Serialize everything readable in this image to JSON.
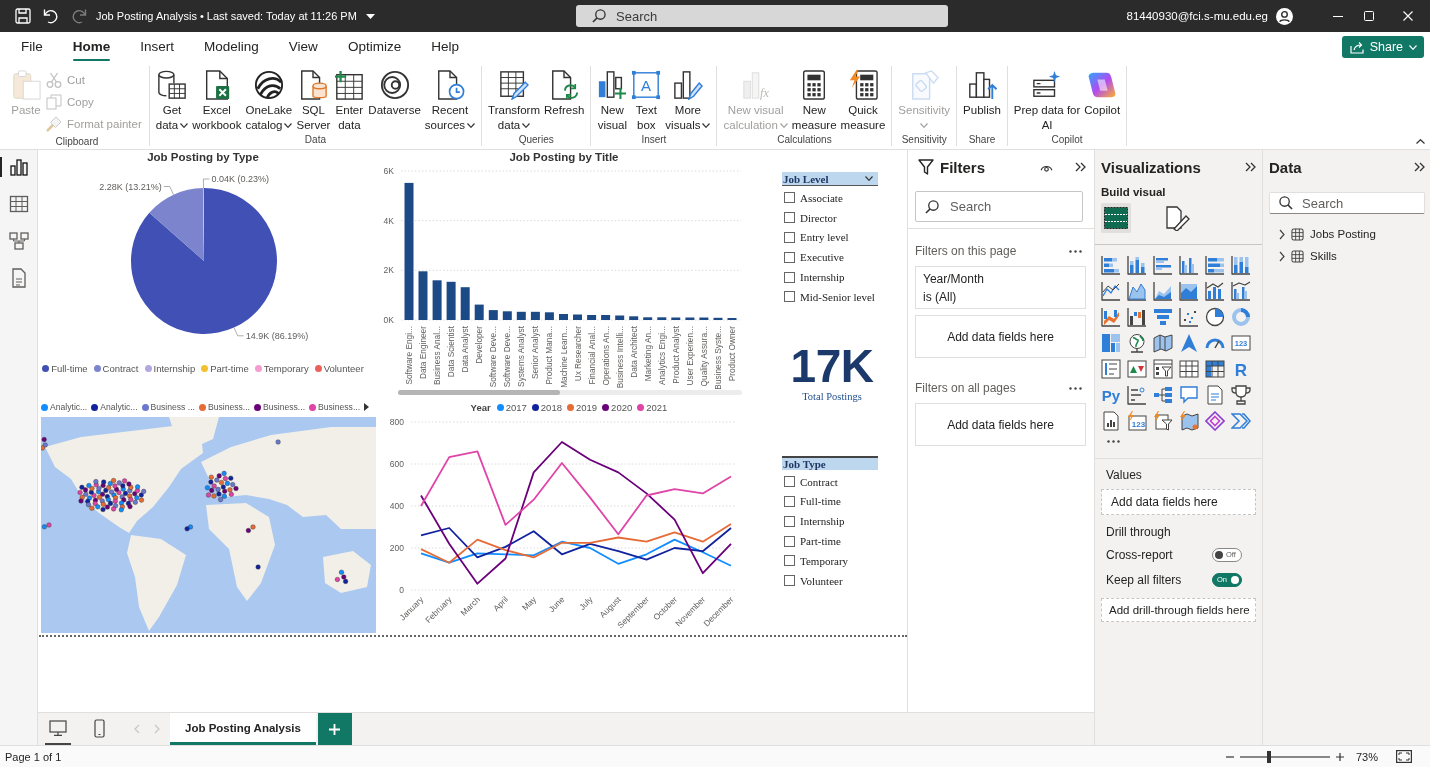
{
  "title_bar": {
    "quick_access": [
      {
        "kind": "save",
        "disabled": false
      },
      {
        "kind": "undo",
        "disabled": false
      },
      {
        "kind": "redo",
        "disabled": true
      }
    ],
    "title": "Job Posting Analysis • Last saved: Today at 11:26 PM",
    "search": {
      "placeholder": "Search"
    },
    "account": "81440930@fci.s-mu.edu.eg"
  },
  "menu_tabs": [
    {
      "label": "File",
      "selected": false
    },
    {
      "label": "Home",
      "selected": true
    },
    {
      "label": "Insert",
      "selected": false
    },
    {
      "label": "Modeling",
      "selected": false
    },
    {
      "label": "View",
      "selected": false
    },
    {
      "label": "Optimize",
      "selected": false
    },
    {
      "label": "Help",
      "selected": false
    }
  ],
  "share_button": {
    "label": "Share"
  },
  "ribbon": {
    "groups": [
      {
        "label": "Clipboard",
        "items": [
          {
            "kind": "large",
            "label": "Paste",
            "dropdown": false,
            "disabled": true
          },
          {
            "kind": "small",
            "label": "Cut",
            "dropdown": false,
            "disabled": true
          },
          {
            "kind": "small",
            "label": "Copy",
            "dropdown": false,
            "disabled": true
          },
          {
            "kind": "small",
            "label": "Format painter",
            "dropdown": false,
            "disabled": true
          }
        ]
      },
      {
        "label": "Data",
        "items": [
          {
            "kind": "large",
            "label": "Get\ndata",
            "dropdown": true,
            "disabled": false
          },
          {
            "kind": "large",
            "label": "Excel\nworkbook",
            "dropdown": false,
            "disabled": false
          },
          {
            "kind": "large",
            "label": "OneLake\ncatalog",
            "dropdown": true,
            "disabled": false
          },
          {
            "kind": "large",
            "label": "SQL\nServer",
            "dropdown": false,
            "disabled": false
          },
          {
            "kind": "large",
            "label": "Enter\ndata",
            "dropdown": false,
            "disabled": false
          },
          {
            "kind": "large",
            "label": "Dataverse",
            "dropdown": false,
            "disabled": false
          },
          {
            "kind": "large",
            "label": "Recent\nsources",
            "dropdown": true,
            "disabled": false
          }
        ]
      },
      {
        "label": "Queries",
        "items": [
          {
            "kind": "large",
            "label": "Transform\ndata",
            "dropdown": true,
            "disabled": false
          },
          {
            "kind": "large",
            "label": "Refresh",
            "dropdown": false,
            "disabled": false
          }
        ]
      },
      {
        "label": "Insert",
        "items": [
          {
            "kind": "large",
            "label": "New\nvisual",
            "dropdown": false,
            "disabled": false
          },
          {
            "kind": "large",
            "label": "Text\nbox",
            "dropdown": false,
            "disabled": false,
            "glyph": "A"
          },
          {
            "kind": "large",
            "label": "More\nvisuals",
            "dropdown": true,
            "disabled": false
          }
        ]
      },
      {
        "label": "Calculations",
        "items": [
          {
            "kind": "large",
            "label": "New visual\ncalculation",
            "dropdown": true,
            "disabled": true,
            "glyph": "fx"
          },
          {
            "kind": "large",
            "label": "New\nmeasure",
            "dropdown": false,
            "disabled": false
          },
          {
            "kind": "large",
            "label": "Quick\nmeasure",
            "dropdown": false,
            "disabled": false
          }
        ]
      },
      {
        "label": "Sensitivity",
        "items": [
          {
            "kind": "large",
            "label": "Sensitivity",
            "dropdown": true,
            "disabled": true
          }
        ]
      },
      {
        "label": "Share",
        "items": [
          {
            "kind": "large",
            "label": "Publish",
            "dropdown": false,
            "disabled": false
          }
        ]
      },
      {
        "label": "Copilot",
        "items": [
          {
            "kind": "large",
            "label": "Prep data for\nAI",
            "dropdown": false,
            "disabled": false
          },
          {
            "kind": "large",
            "label": "Copilot",
            "dropdown": false,
            "disabled": false
          }
        ]
      }
    ]
  },
  "view_rail": [
    {
      "kind": "report",
      "selected": true
    },
    {
      "kind": "table",
      "selected": false
    },
    {
      "kind": "model",
      "selected": false
    },
    {
      "kind": "query",
      "selected": false
    }
  ],
  "canvas": {
    "pie_chart": {
      "chart_data": {
        "type": "pie",
        "title": "Job Posting by Type",
        "categories": [
          "Full-time",
          "Contract",
          "Internship",
          "Part-time",
          "Temporary",
          "Volunteer"
        ],
        "values": [
          14900,
          2280,
          null,
          40,
          null,
          null
        ],
        "colors": [
          "#4150b4",
          "#7b84cc",
          "#b3a6e3",
          "#f2c12e",
          "#f59ccf",
          "#e8625a"
        ],
        "value_labels": [
          "14.9K (86.19%)",
          "2.28K (13.21%)",
          null,
          "0.04K (0.23%)",
          null,
          null
        ],
        "legend": "bottom"
      }
    },
    "bar_chart": {
      "chart_data": {
        "type": "bar",
        "title": "Job Posting by Title",
        "categories": [
          "Software Engi...",
          "Data Engineer",
          "Business Anal...",
          "Data Scientist",
          "Data Analyst",
          "Developer",
          "Software Deve...",
          "Software Deve...",
          "Systems Analyst",
          "Senior Analyst",
          "Product Mana...",
          "Machine Learn...",
          "Ux Researcher",
          "Financial Anal...",
          "Operations An...",
          "Business Intelli...",
          "Data Architect",
          "Marketing An...",
          "Analytics Engi...",
          "Product Analyst",
          "User Experien...",
          "Quality Assura...",
          "Business Syste...",
          "Product Owner"
        ],
        "values": [
          5520,
          1960,
          1600,
          1540,
          1320,
          620,
          400,
          350,
          330,
          330,
          310,
          240,
          220,
          200,
          200,
          180,
          150,
          110,
          110,
          100,
          100,
          100,
          90,
          80
        ],
        "color": "#1c4a86",
        "ylim": [
          0,
          6000
        ],
        "yticks": [
          {
            "value": 0,
            "label": "0K"
          },
          {
            "value": 2000,
            "label": "2K"
          },
          {
            "value": 4000,
            "label": "4K"
          },
          {
            "value": 6000,
            "label": "6K"
          }
        ],
        "grid": true
      }
    },
    "job_level_slicer": {
      "title": "Job Level",
      "dropdown": true,
      "items": [
        {
          "label": "Associate",
          "checked": false
        },
        {
          "label": "Director",
          "checked": false
        },
        {
          "label": "Entry level",
          "checked": false
        },
        {
          "label": "Executive",
          "checked": false
        },
        {
          "label": "Internship",
          "checked": false
        },
        {
          "label": "Mid-Senior level",
          "checked": false
        }
      ]
    },
    "card": {
      "value": "17K",
      "label": "Total Postings"
    },
    "map": {
      "legend": [
        {
          "label": "Analytic...",
          "color": "#118dff"
        },
        {
          "label": "Analytic...",
          "color": "#12239e"
        },
        {
          "label": "Business ...",
          "color": "#6b78cf"
        },
        {
          "label": "Business...",
          "color": "#e66c37"
        },
        {
          "label": "Business...",
          "color": "#6b007b"
        },
        {
          "label": "Business...",
          "color": "#e044a7"
        }
      ]
    },
    "line_chart": {
      "chart_data": {
        "type": "line",
        "legend_title": "Year",
        "legend": "top",
        "categories": [
          "January",
          "February",
          "March",
          "April",
          "May",
          "June",
          "July",
          "August",
          "September",
          "October",
          "November",
          "December"
        ],
        "series": [
          {
            "name": "2017",
            "color": "#118dff",
            "values": [
              175,
              130,
              175,
              170,
              165,
              230,
              200,
              125,
              170,
              240,
              180,
              115
            ]
          },
          {
            "name": "2018",
            "color": "#12239e",
            "values": [
              260,
              295,
              155,
              205,
              280,
              170,
              220,
              185,
              145,
              200,
              185,
              295
            ]
          },
          {
            "name": "2019",
            "color": "#e66c37",
            "values": [
              195,
              130,
              240,
              190,
              155,
              225,
              225,
              250,
              230,
              275,
              230,
              315
            ]
          },
          {
            "name": "2020",
            "color": "#6b007b",
            "values": [
              450,
              220,
              30,
              150,
              560,
              705,
              620,
              560,
              460,
              335,
              80,
              220
            ]
          },
          {
            "name": "2021",
            "color": "#e044a7",
            "values": [
              400,
              633,
              660,
              310,
              430,
              605,
              440,
              265,
              450,
              480,
              460,
              540
            ]
          }
        ],
        "ylim": [
          0,
          800
        ],
        "yticks": [
          0,
          200,
          400,
          600,
          800
        ],
        "grid": true
      }
    },
    "job_type_slicer": {
      "title": "Job Type",
      "dropdown": false,
      "items": [
        {
          "label": "Contract",
          "checked": false
        },
        {
          "label": "Full-time",
          "checked": false
        },
        {
          "label": "Internship",
          "checked": false
        },
        {
          "label": "Part-time",
          "checked": false
        },
        {
          "label": "Temporary",
          "checked": false
        },
        {
          "label": "Volunteer",
          "checked": false
        }
      ]
    }
  },
  "filters_pane": {
    "title": "Filters",
    "search": {
      "placeholder": "Search"
    },
    "sections": [
      {
        "title": "Filters on this page",
        "items": [
          {
            "kind": "filter",
            "field": "Year/Month",
            "condition": "is (All)"
          },
          {
            "kind": "drop",
            "label": "Add data fields here"
          }
        ]
      },
      {
        "title": "Filters on all pages",
        "items": [
          {
            "kind": "drop",
            "label": "Add data fields here"
          }
        ]
      }
    ]
  },
  "visualizations_pane": {
    "title": "Visualizations",
    "subtitle": "Build visual",
    "modes": [
      {
        "kind": "build",
        "selected": true
      },
      {
        "kind": "format",
        "selected": false
      }
    ],
    "gallery": [
      {
        "kind": "stackedbar"
      },
      {
        "kind": "stackedcolumn"
      },
      {
        "kind": "clusteredbar"
      },
      {
        "kind": "clusteredcolumn"
      },
      {
        "kind": "fullbar"
      },
      {
        "kind": "fullcolumn"
      },
      {
        "kind": "line"
      },
      {
        "kind": "area"
      },
      {
        "kind": "stackedarea"
      },
      {
        "kind": "fullarea"
      },
      {
        "kind": "linecolumn"
      },
      {
        "kind": "lineclustered"
      },
      {
        "kind": "ribbon"
      },
      {
        "kind": "waterfall"
      },
      {
        "kind": "funnel"
      },
      {
        "kind": "scatter"
      },
      {
        "kind": "pie"
      },
      {
        "kind": "donut"
      },
      {
        "kind": "treemap"
      },
      {
        "kind": "globe"
      },
      {
        "kind": "filledmap"
      },
      {
        "kind": "azuremap"
      },
      {
        "kind": "gauge"
      },
      {
        "kind": "card",
        "glyph": "123"
      },
      {
        "kind": "multicard"
      },
      {
        "kind": "kpi"
      },
      {
        "kind": "slicer"
      },
      {
        "kind": "table"
      },
      {
        "kind": "matrix"
      },
      {
        "kind": "rscript",
        "glyph": "R"
      },
      {
        "kind": "python",
        "glyph": "Py"
      },
      {
        "kind": "influencers"
      },
      {
        "kind": "decomposition"
      },
      {
        "kind": "qna"
      },
      {
        "kind": "narrative"
      },
      {
        "kind": "goals"
      },
      {
        "kind": "paginated"
      },
      {
        "kind": "cardnew",
        "glyph": "123"
      },
      {
        "kind": "slicernew"
      },
      {
        "kind": "mapnew"
      },
      {
        "kind": "apps"
      },
      {
        "kind": "automate"
      }
    ],
    "wells": [
      {
        "title": "Values",
        "drop_zone": "Add data fields here"
      }
    ],
    "drill_through": {
      "title": "Drill through",
      "toggles": [
        {
          "label": "Cross-report",
          "on": false,
          "state_label": "Off"
        },
        {
          "label": "Keep all filters",
          "on": true,
          "state_label": "On"
        }
      ],
      "drop_zone": "Add drill-through fields here"
    }
  },
  "data_pane": {
    "title": "Data",
    "search": {
      "placeholder": "Search"
    },
    "tables": [
      {
        "label": "Jobs Posting",
        "expanded": false
      },
      {
        "label": "Skills",
        "expanded": false
      }
    ]
  },
  "page_bar": {
    "views": [
      {
        "kind": "desktop",
        "selected": true
      },
      {
        "kind": "mobile",
        "selected": false
      }
    ],
    "nav": [
      {
        "kind": "previous",
        "disabled": true
      },
      {
        "kind": "next",
        "disabled": true
      }
    ],
    "pages": [
      {
        "label": "Job Posting Analysis",
        "selected": true
      }
    ]
  },
  "status_bar": {
    "page": "Page 1 of 1",
    "zoom": {
      "level": 0.32,
      "reading": "73%"
    }
  }
}
